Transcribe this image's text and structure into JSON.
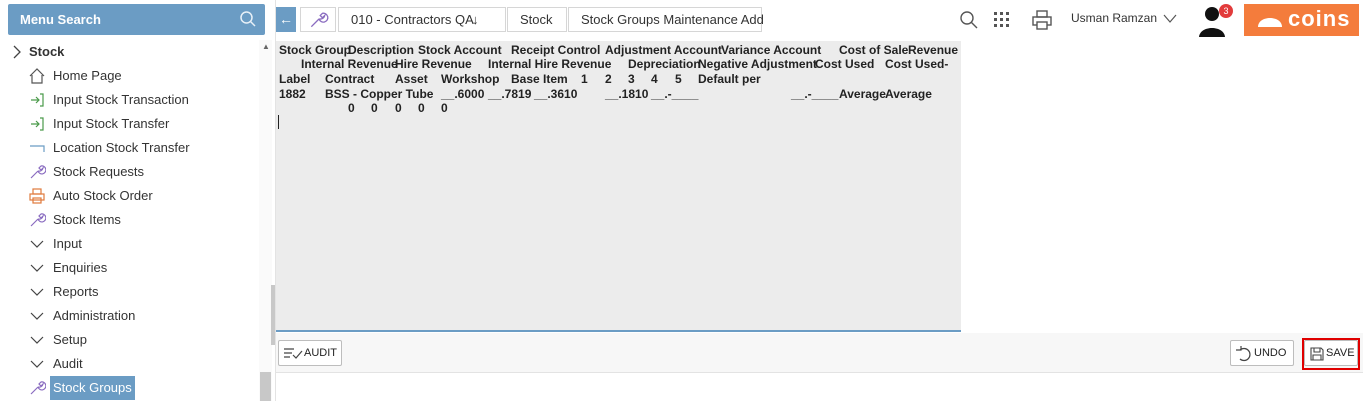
{
  "sidebar": {
    "search_label": "Menu Search",
    "root": "Stock",
    "items": [
      {
        "label": "Home Page",
        "icon": "home-icon"
      },
      {
        "label": "Input Stock Transaction",
        "icon": "input-arrow-icon"
      },
      {
        "label": "Input Stock Transfer",
        "icon": "input-arrow-icon"
      },
      {
        "label": "Location Stock Transfer",
        "icon": "bracket-icon"
      },
      {
        "label": "Stock Requests",
        "icon": "wrench-icon"
      },
      {
        "label": "Auto Stock Order",
        "icon": "printer-icon"
      },
      {
        "label": "Stock Items",
        "icon": "wrench-icon"
      },
      {
        "label": "Input",
        "icon": "chevron-down-icon"
      },
      {
        "label": "Enquiries",
        "icon": "chevron-down-icon"
      },
      {
        "label": "Reports",
        "icon": "chevron-down-icon"
      },
      {
        "label": "Administration",
        "icon": "chevron-down-icon"
      },
      {
        "label": "Setup",
        "icon": "chevron-down-icon"
      },
      {
        "label": "Audit",
        "icon": "chevron-down-icon"
      },
      {
        "label": "Stock Groups",
        "icon": "wrench-icon",
        "active": true
      }
    ]
  },
  "breadcrumb": {
    "company": "010 - Contractors QA",
    "module": "Stock",
    "page": "Stock Groups Maintenance Add"
  },
  "header": {
    "user": "Usman Ramzan",
    "notification_count": "3",
    "logo_text": "coins"
  },
  "grid": {
    "header_row1": [
      "Stock Group",
      "Description",
      "Stock Account",
      "Receipt Control",
      "Adjustment Account",
      "Variance Account",
      "Cost of Sale",
      "Revenue"
    ],
    "header_row2": [
      "Internal Revenue",
      "Hire Revenue",
      "Internal Hire Revenue",
      "Depreciation",
      "Negative Adjustment",
      "Cost Used",
      "Cost Used-"
    ],
    "header_row3": [
      "Label",
      "Contract",
      "Asset",
      "Workshop",
      "Base Item",
      "1",
      "2",
      "3",
      "4",
      "5",
      "Default per"
    ],
    "data_row1": [
      "1882",
      "BSS - Copper Tube",
      "__.6000",
      "__.7819",
      "__.3610",
      "__.1810",
      "__.-____",
      "__.-____",
      "Average",
      "Average"
    ],
    "data_row2": [
      "0",
      "0",
      "0",
      "0",
      "0"
    ]
  },
  "toolbar": {
    "audit_label": "AUDIT",
    "undo_label": "UNDO",
    "save_label": "SAVE"
  },
  "colors": {
    "accent": "#6b9cc4",
    "logo": "#f47c3c",
    "highlight": "#e00000"
  }
}
